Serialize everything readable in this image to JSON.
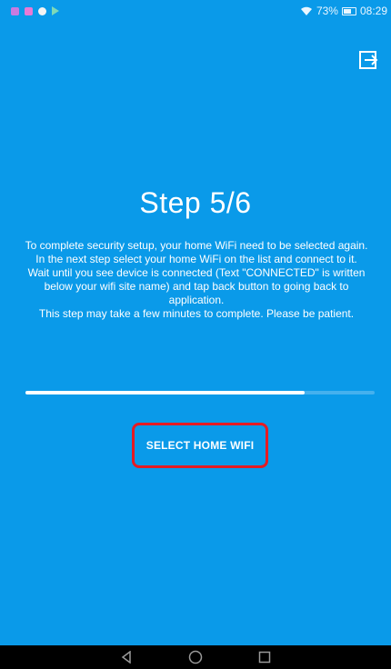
{
  "status_bar": {
    "battery_percent": "73%",
    "battery_level": 0.73,
    "time": "08:29",
    "notification_icons": [
      "app-notification-icon",
      "app-notification-icon",
      "app-notification-icon",
      "play-store-icon"
    ],
    "notification_colors": [
      "#c87be0",
      "#e87ad6",
      "#f3f3f3",
      "#7ed8b8"
    ]
  },
  "header": {
    "exit_icon": "exit-icon"
  },
  "main": {
    "title": "Step 5/6",
    "instructions": [
      "To complete security setup, your home WiFi need to be selected again.",
      "In the next step select your home WiFi on the list and connect to it.",
      "Wait until you see device is connected (Text \"CONNECTED\" is written below your wifi site name) and tap back button to going back to application.",
      "This step may take a few minutes to complete. Please be patient."
    ],
    "progress": 0.8,
    "select_button_label": "SELECT HOME WIFI",
    "highlight_color": "#e51b23"
  },
  "nav_bar": {
    "buttons": [
      "back-icon",
      "home-icon",
      "recents-icon"
    ]
  },
  "colors": {
    "background": "#0a9ae9",
    "text": "#ffffff"
  }
}
